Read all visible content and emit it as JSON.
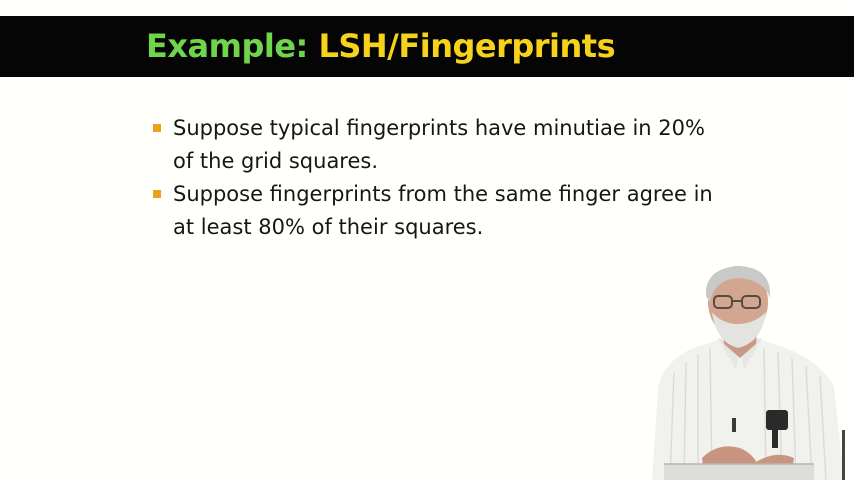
{
  "slide": {
    "title_part1": "Example:",
    "title_part2": "LSH/Fingerprints",
    "bullets": [
      "Suppose typical fingerprints have minutiae in 20% of the grid squares.",
      "Suppose fingerprints from the same finger agree in at least 80% of their squares."
    ]
  },
  "colors": {
    "title_bar": "#050505",
    "title_green": "#6fd64c",
    "title_yellow": "#f7d21b",
    "bullet_marker": "#e9a21c",
    "background": "#fffffb",
    "text": "#161616"
  }
}
